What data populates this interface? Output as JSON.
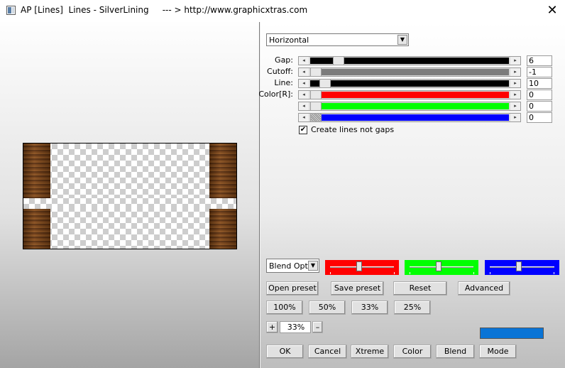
{
  "window": {
    "title": "AP [Lines]  Lines - SilverLining     --- > http://www.graphicxtras.com",
    "close_glyph": "✕"
  },
  "direction": {
    "selected": "Horizontal",
    "arrow": "▼"
  },
  "sliders": [
    {
      "label": "Gap:",
      "value": "6",
      "track_color": "#000000",
      "level": 0.12
    },
    {
      "label": "Cutoff:",
      "value": "-1",
      "track_color": "#7c7c7c",
      "level": 0.0
    },
    {
      "label": "Line:",
      "value": "10",
      "track_color": "#000000",
      "level": 0.05
    },
    {
      "label": "Color[R]:",
      "value": "0",
      "track_color": "#ff0000",
      "level": 0.0
    },
    {
      "label": "",
      "value": "0",
      "track_color": "#00ff00",
      "level": 0.0
    },
    {
      "label": "",
      "value": "0",
      "track_color": "#0000ff",
      "level": 0.0
    }
  ],
  "slider_arrows": {
    "left": "◂",
    "right": "▸"
  },
  "checkbox": {
    "label": "Create lines not gaps",
    "checked": true,
    "mark": "✔"
  },
  "blend": {
    "selected": "Blend Optio",
    "arrow": "▼"
  },
  "color_sliders": [
    {
      "color": "#ff0000",
      "level": 0.45
    },
    {
      "color": "#00ff00",
      "level": 0.45
    },
    {
      "color": "#0000ff",
      "level": 0.45
    }
  ],
  "buttons": {
    "open_preset": "Open preset",
    "save_preset": "Save preset",
    "reset": "Reset",
    "advanced": "Advanced",
    "zoom_100": "100%",
    "zoom_50": "50%",
    "zoom_33": "33%",
    "zoom_25": "25%",
    "zoom_plus": "+",
    "zoom_minus": "–",
    "ok": "OK",
    "cancel": "Cancel",
    "xtreme": "Xtreme",
    "color": "Color",
    "blend": "Blend",
    "mode": "Mode"
  },
  "zoom_value": "33%",
  "swatch_color": "#0a74d6"
}
